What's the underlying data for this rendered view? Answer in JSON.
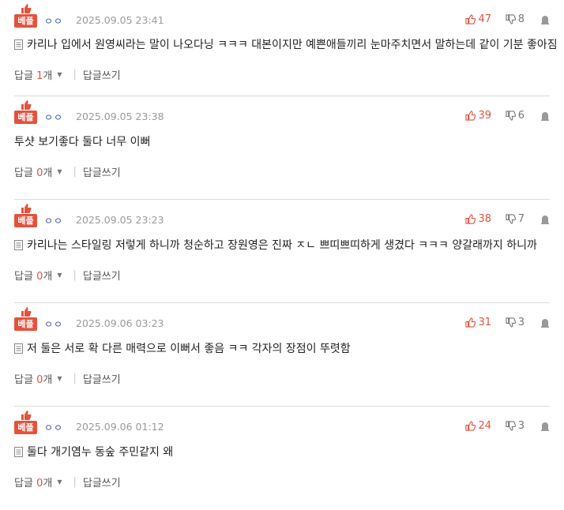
{
  "best_label": "베플",
  "reply_label": "답글",
  "reply_count_suffix": "개",
  "write_reply_label": "답글쓰기",
  "accent": "#e4523c",
  "comments": [
    {
      "nick": "ㅇㅇ",
      "date": "2025.09.05 23:41",
      "up": "47",
      "down": "8",
      "text": "카리나 입에서 원영씨라는 말이 나오다닝 ㅋㅋㅋ 대본이지만 예쁜애들끼리 눈마주치면서 말하는데 같이 기분 좋아짐",
      "replies": "1"
    },
    {
      "nick": "ㅇㅇ",
      "date": "2025.09.05 23:38",
      "up": "39",
      "down": "6",
      "text": "투샷 보기좋다 둘다 너무 이뻐",
      "replies": "0"
    },
    {
      "nick": "ㅇㅇ",
      "date": "2025.09.05 23:23",
      "up": "38",
      "down": "7",
      "text": "카리나는 스타일링 저렇게 하니까 청순하고 장원영은 진짜 ㅈㄴ 쁘띠쁘띠하게 생겼다 ㅋㅋㅋ 양갈래까지 하니까",
      "replies": "0"
    },
    {
      "nick": "ㅇㅇ",
      "date": "2025.09.06 03:23",
      "up": "31",
      "down": "3",
      "text": "저 둘은 서로 확 다른 매력으로 이뻐서 좋음 ㅋㅋ 각자의 장점이 뚜렷함",
      "replies": "0"
    },
    {
      "nick": "ㅇㅇ",
      "date": "2025.09.06 01:12",
      "up": "24",
      "down": "3",
      "text": "둘다 개기염누 동숲 주민같지 왜",
      "replies": "0"
    }
  ]
}
